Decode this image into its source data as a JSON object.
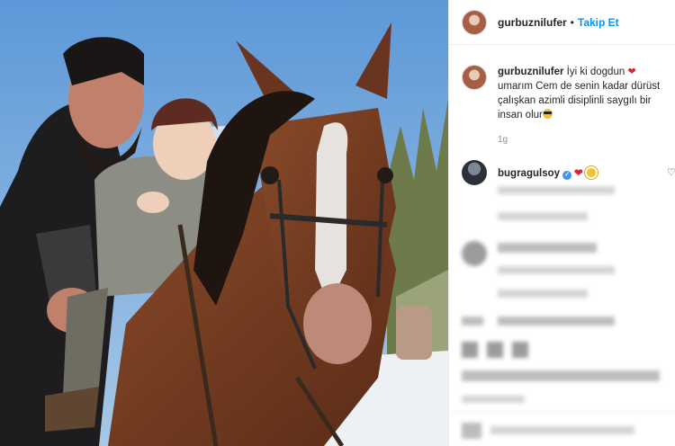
{
  "post": {
    "username": "gurbuznilufer",
    "separator": "•",
    "follow_label": "Takip Et"
  },
  "caption": {
    "username": "gurbuznilufer",
    "text_before": "İyi ki dogdun",
    "text_after": "umarım Cem de senin kadar dürüst çalışkan azimli disiplinli saygılı bir insan olur",
    "time": "1g"
  },
  "comments": [
    {
      "username": "bugragulsoy",
      "icons": [
        "verified-badge",
        "red-heart",
        "sun"
      ]
    }
  ],
  "icons": [
    "heart-icon",
    "verified-icon",
    "sun-emoji",
    "sunglasses-emoji"
  ],
  "colors": {
    "accent": "#0095f6",
    "heart": "#d9252d",
    "text": "#262626",
    "muted": "#8e8e8e"
  }
}
